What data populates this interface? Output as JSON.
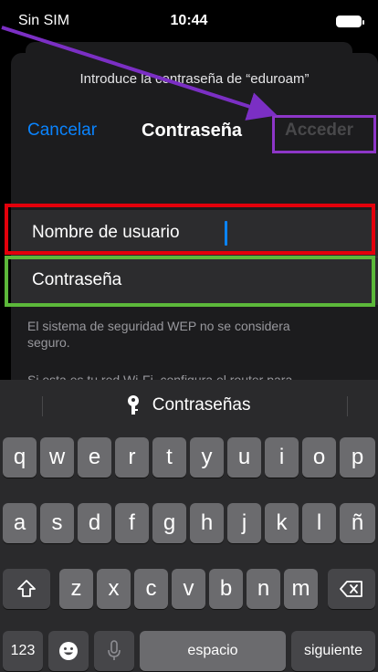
{
  "status": {
    "carrier": "Sin SIM",
    "time": "10:44"
  },
  "dialog": {
    "prompt": "Introduce la contraseña de “eduroam”",
    "cancel_label": "Cancelar",
    "title": "Contraseña",
    "join_label": "Acceder",
    "username_label": "Nombre de usuario",
    "password_label": "Contraseña",
    "warning": "El sistema de seguridad WEP no se considera seguro.",
    "note": "Si esta es tu red Wi-Fi, configura el router para"
  },
  "keyboard": {
    "suggestion": "Contraseñas",
    "row1": [
      "q",
      "w",
      "e",
      "r",
      "t",
      "y",
      "u",
      "i",
      "o",
      "p"
    ],
    "row2": [
      "a",
      "s",
      "d",
      "f",
      "g",
      "h",
      "j",
      "k",
      "l",
      "ñ"
    ],
    "row3": [
      "z",
      "x",
      "c",
      "v",
      "b",
      "n",
      "m"
    ],
    "numbers_label": "123",
    "space_label": "espacio",
    "next_label": "siguiente"
  },
  "colors": {
    "accent": "#0a84ff",
    "highlight_red": "#e3000b",
    "highlight_green": "#5cb83a",
    "highlight_purple": "#8d36c8"
  }
}
